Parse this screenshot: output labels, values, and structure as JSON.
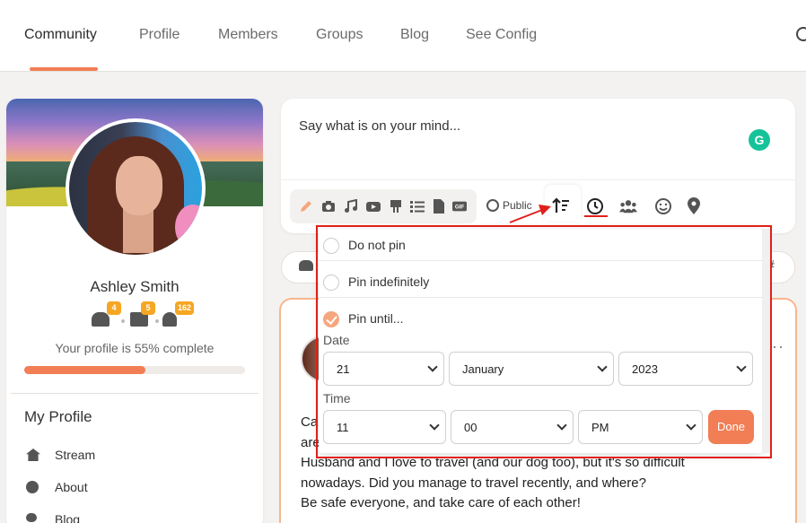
{
  "nav": {
    "tabs": [
      {
        "label": "Community"
      },
      {
        "label": "Profile"
      },
      {
        "label": "Members"
      },
      {
        "label": "Groups"
      },
      {
        "label": "Blog"
      },
      {
        "label": "See Config"
      }
    ],
    "active_tab": "Community"
  },
  "profile": {
    "name": "Ashley Smith",
    "friends_count": "4",
    "messages_count": "5",
    "notifications_count": "162",
    "completion_text": "Your profile is 55% complete",
    "completion_percent": 55
  },
  "sidebar": {
    "heading": "My Profile",
    "items": [
      {
        "label": "Stream",
        "icon": "home-icon"
      },
      {
        "label": "About",
        "icon": "user-circle-icon"
      },
      {
        "label": "Blog",
        "icon": "quote-icon"
      }
    ]
  },
  "composer": {
    "placeholder": "Say what is on your mind...",
    "privacy_label": "Public"
  },
  "pin_menu": {
    "options": [
      {
        "label": "Do not pin",
        "checked": false
      },
      {
        "label": "Pin indefinitely",
        "checked": false
      },
      {
        "label": "Pin until...",
        "checked": true
      }
    ],
    "date_label": "Date",
    "time_label": "Time",
    "day": "21",
    "month": "January",
    "year": "2023",
    "hour": "11",
    "minute": "00",
    "ampm": "PM",
    "done_label": "Done"
  },
  "post": {
    "lines": [
      "Ca",
      "are",
      "Husband and I love to travel (and our dog too), but it's so difficult",
      "nowadays. Did you manage to travel recently, and where?",
      "Be safe everyone, and take care of each other!"
    ]
  },
  "colors": {
    "accent": "#f17e55",
    "annotation": "#e0201b",
    "badge": "#f5a623"
  }
}
